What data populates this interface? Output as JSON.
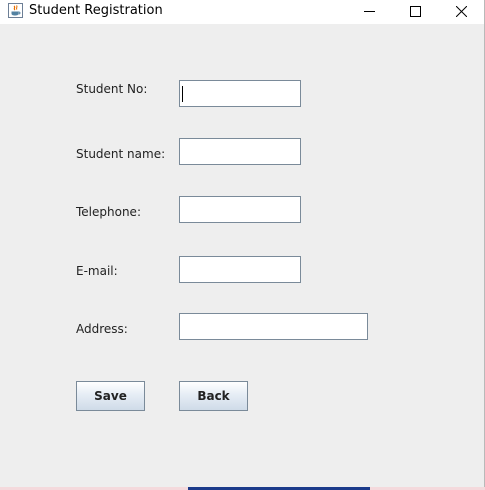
{
  "window": {
    "title": "Student Registration",
    "controls": {
      "minimize": "minimize-icon",
      "maximize": "maximize-icon",
      "close": "close-icon"
    }
  },
  "form": {
    "fields": [
      {
        "label": "Student No:",
        "value": "",
        "focused": true
      },
      {
        "label": "Student name:",
        "value": ""
      },
      {
        "label": "Telephone:",
        "value": ""
      },
      {
        "label": "E-mail:",
        "value": ""
      },
      {
        "label": "Address:",
        "value": ""
      }
    ],
    "buttons": {
      "save_label": "Save",
      "back_label": "Back"
    }
  },
  "colors": {
    "window_bg": "#eeeeee",
    "field_border": "#7a8a99",
    "button_gradient_top": "#ffffff",
    "button_gradient_bottom": "#cfdbe8"
  }
}
